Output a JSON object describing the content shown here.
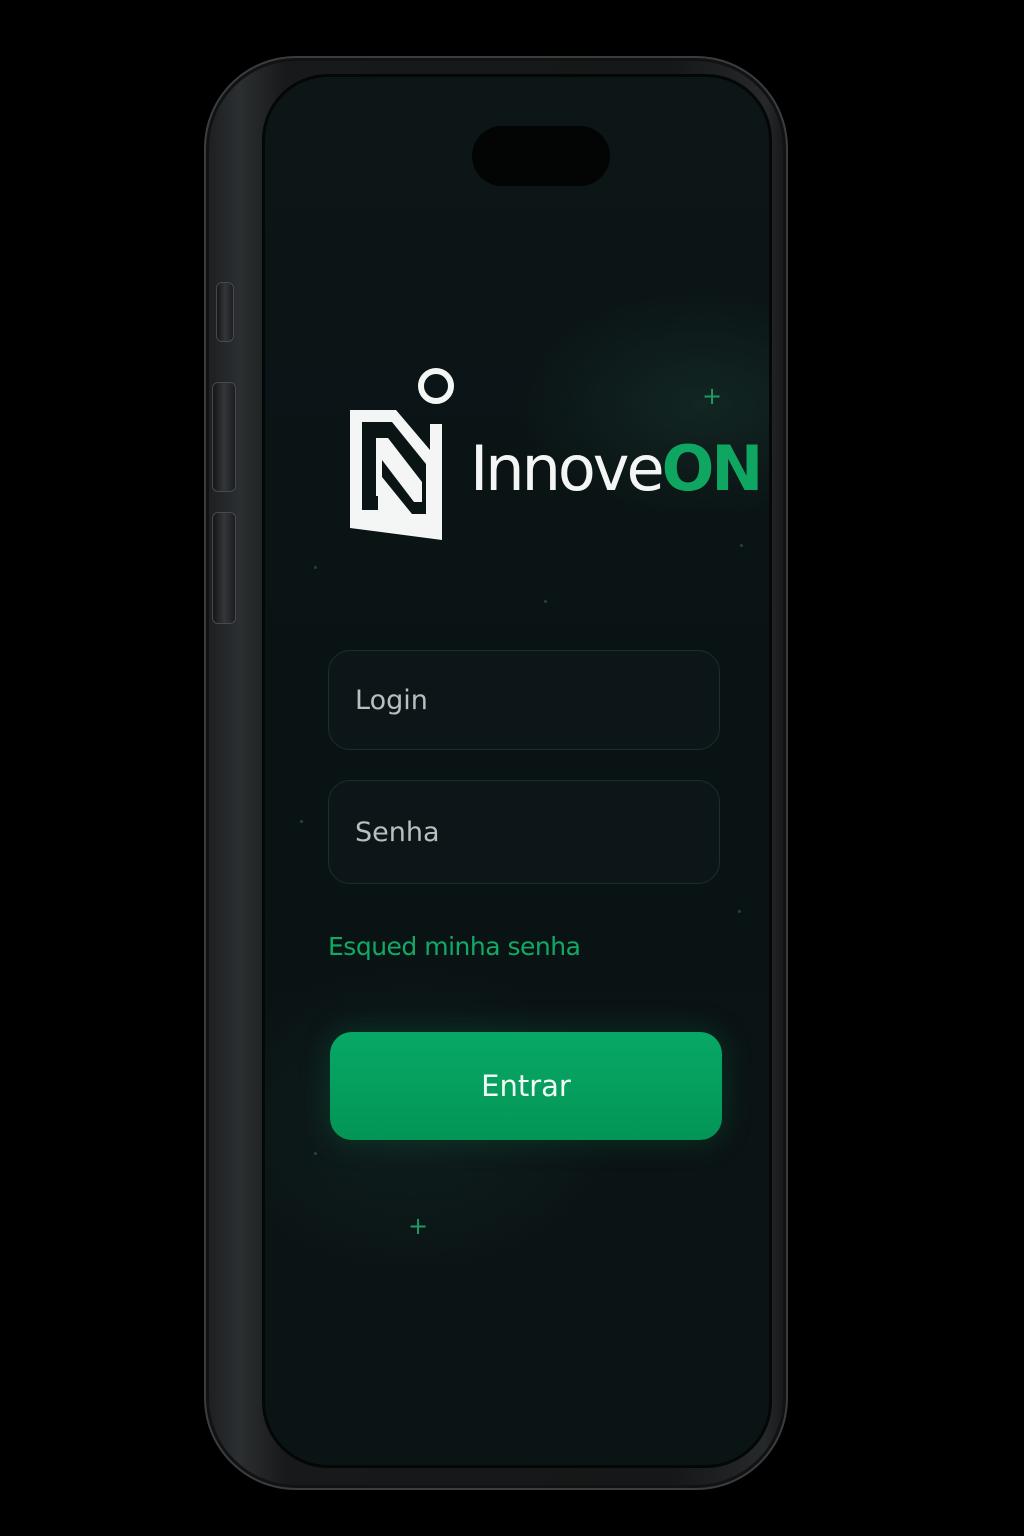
{
  "app": {
    "brand_primary": "Innove",
    "brand_accent": "ON",
    "accent_color": "#0fa661"
  },
  "login_form": {
    "login_placeholder": "Login",
    "password_placeholder": "Senha",
    "forgot_password_label": "Esqued minha senha",
    "submit_label": "Entrar",
    "submit_color": "#07a866"
  },
  "icons": {
    "logo": "innoveon-n-logo-icon",
    "sparkle": "plus-sparkle-icon"
  }
}
